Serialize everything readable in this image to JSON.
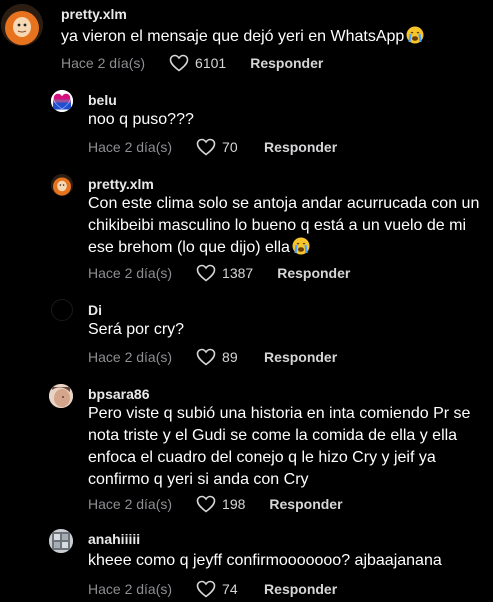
{
  "comments": [
    {
      "username": "pretty.xlm",
      "text": "ya vieron el mensaje que dejó yeri en WhatsApp",
      "emoji": "loudly-crying-face",
      "date": "Hace 2 día(s)",
      "likes": "6101",
      "reply": "Responder"
    },
    {
      "username": "belu",
      "text": "noo q puso???",
      "date": "Hace 2 día(s)",
      "likes": "70",
      "reply": "Responder"
    },
    {
      "username": "pretty.xlm",
      "text": "Con este clima solo se antoja andar acurrucada con un chikibeibi masculino lo bueno q está a un vuelo de mi ese brehom (lo que dijo) ella",
      "emoji": "loudly-crying-face",
      "date": "Hace 2 día(s)",
      "likes": "1387",
      "reply": "Responder"
    },
    {
      "username": "Di",
      "text": "Será por cry?",
      "date": "Hace 2 día(s)",
      "likes": "89",
      "reply": "Responder"
    },
    {
      "username": "bpsara86",
      "text": "Pero viste q subió una historia en inta comiendo Pr se nota triste y el Gudi se come la comida de ella y ella enfoca el cuadro del conejo q le hizo Cry y jeif ya confirmo q yeri si anda con Cry",
      "date": "Hace 2 día(s)",
      "likes": "198",
      "reply": "Responder"
    },
    {
      "username": "anahiiiii",
      "text": "kheee como q jeyff confirmooooooo? ajbaajanana",
      "date": "Hace 2 día(s)",
      "likes": "74",
      "reply": "Responder"
    }
  ],
  "colors": {
    "background": "#000000",
    "text": "#ffffff",
    "muted": "#8e8e93"
  }
}
